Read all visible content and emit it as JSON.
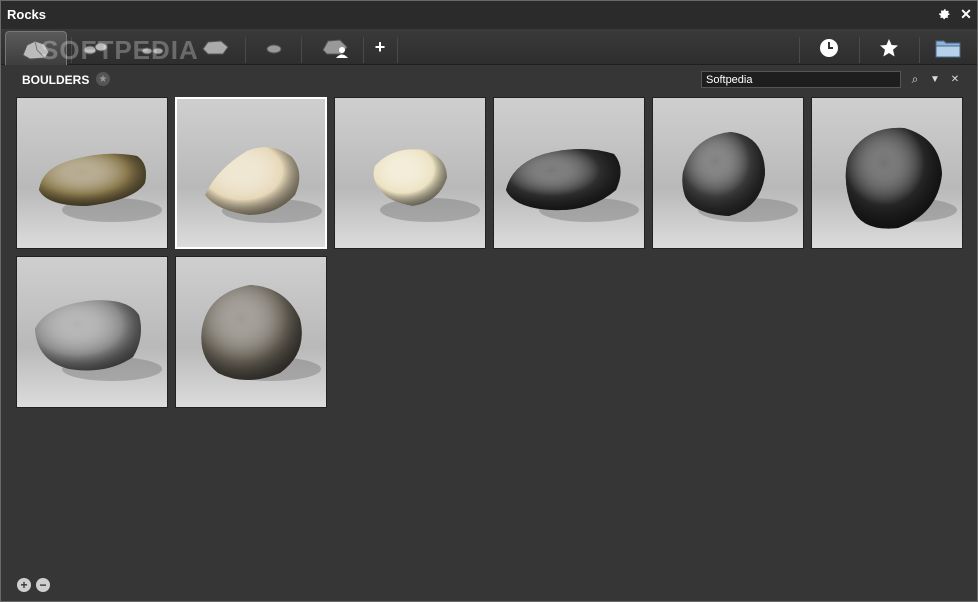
{
  "window": {
    "title": "Rocks"
  },
  "titlebar": {
    "settings_icon": "gear-icon",
    "close_glyph": "✕"
  },
  "tabs": {
    "watermark": "SOFTPEDIA",
    "add_glyph": "+",
    "right_icons": [
      "clock-icon",
      "star-icon",
      "folder-icon"
    ]
  },
  "section": {
    "title": "BOULDERS",
    "star": "★"
  },
  "search": {
    "value": "Softpedia",
    "search_glyph": "⌕",
    "dropdown_glyph": "▼",
    "clear_glyph": "✕"
  },
  "thumbnails": [
    {
      "name": "rock-1",
      "color": "#8b7a4e"
    },
    {
      "name": "rock-2",
      "color": "#e6d8b8"
    },
    {
      "name": "rock-3",
      "color": "#ece2c2"
    },
    {
      "name": "rock-4",
      "color": "#2e2e2e"
    },
    {
      "name": "rock-5",
      "color": "#3a3a3a"
    },
    {
      "name": "rock-6",
      "color": "#262626"
    },
    {
      "name": "rock-7",
      "color": "#8a8a8a"
    },
    {
      "name": "rock-8",
      "color": "#6b655a"
    }
  ],
  "footer": {
    "zoom_in": "+",
    "zoom_out": "−"
  }
}
